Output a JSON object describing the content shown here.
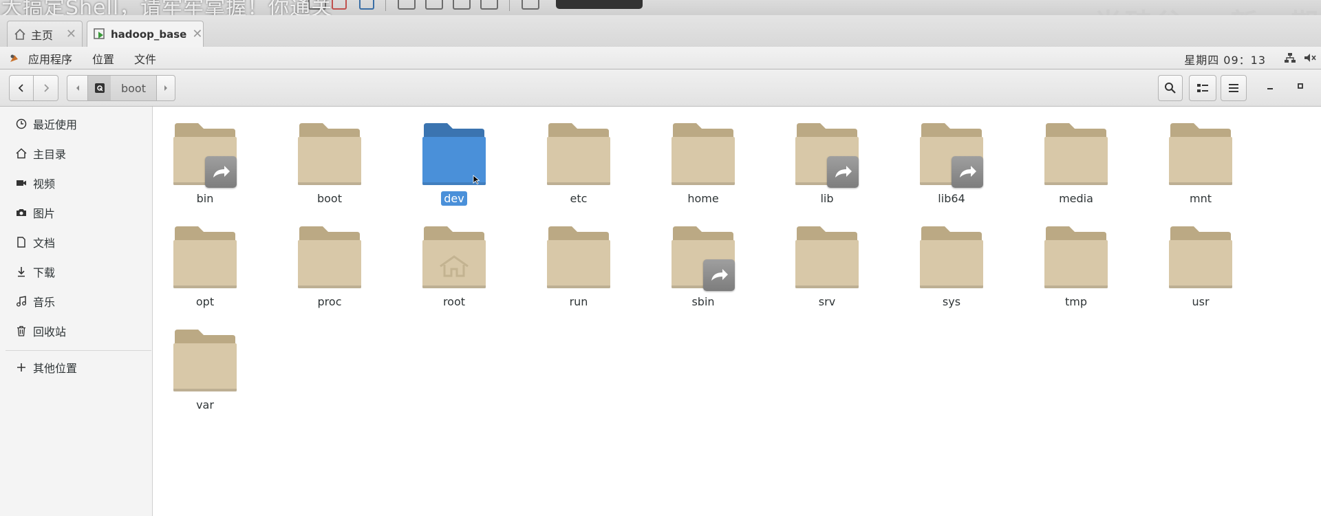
{
  "subtitle": "大搞定Shell，请牢牢掌握！你通关",
  "watermark": "尚硅谷 • 新一期",
  "tabs": [
    {
      "label": "主页",
      "icon": "home-icon"
    },
    {
      "label": "hadoop_base",
      "icon": "vm-icon"
    }
  ],
  "panel": {
    "apps": "应用程序",
    "places": "位置",
    "file": "文件",
    "clock": "星期四 09：13"
  },
  "header": {
    "breadcrumb": "boot"
  },
  "sidebar": {
    "items": [
      {
        "label": "最近使用",
        "icon": "clock-icon"
      },
      {
        "label": "主目录",
        "icon": "home-icon"
      },
      {
        "label": "视频",
        "icon": "video-icon"
      },
      {
        "label": "图片",
        "icon": "camera-icon"
      },
      {
        "label": "文档",
        "icon": "document-icon"
      },
      {
        "label": "下载",
        "icon": "download-icon"
      },
      {
        "label": "音乐",
        "icon": "music-icon"
      },
      {
        "label": "回收站",
        "icon": "trash-icon"
      }
    ],
    "other": {
      "label": "其他位置",
      "icon": "plus-icon"
    }
  },
  "files": [
    {
      "name": "bin",
      "link": true
    },
    {
      "name": "boot",
      "link": false
    },
    {
      "name": "dev",
      "link": false,
      "selected": true
    },
    {
      "name": "etc",
      "link": false
    },
    {
      "name": "home",
      "link": false
    },
    {
      "name": "lib",
      "link": true
    },
    {
      "name": "lib64",
      "link": true
    },
    {
      "name": "media",
      "link": false
    },
    {
      "name": "mnt",
      "link": false
    },
    {
      "name": "opt",
      "link": false
    },
    {
      "name": "proc",
      "link": false
    },
    {
      "name": "root",
      "link": false,
      "home_emblem": true
    },
    {
      "name": "run",
      "link": false
    },
    {
      "name": "sbin",
      "link": true
    },
    {
      "name": "srv",
      "link": false
    },
    {
      "name": "sys",
      "link": false
    },
    {
      "name": "tmp",
      "link": false
    },
    {
      "name": "usr",
      "link": false
    },
    {
      "name": "var",
      "link": false
    }
  ],
  "colors": {
    "folder": "#d8c8a8",
    "folder_tab": "#bba984",
    "folder_selected": "#4a90d9",
    "selection": "#4a90d9"
  }
}
